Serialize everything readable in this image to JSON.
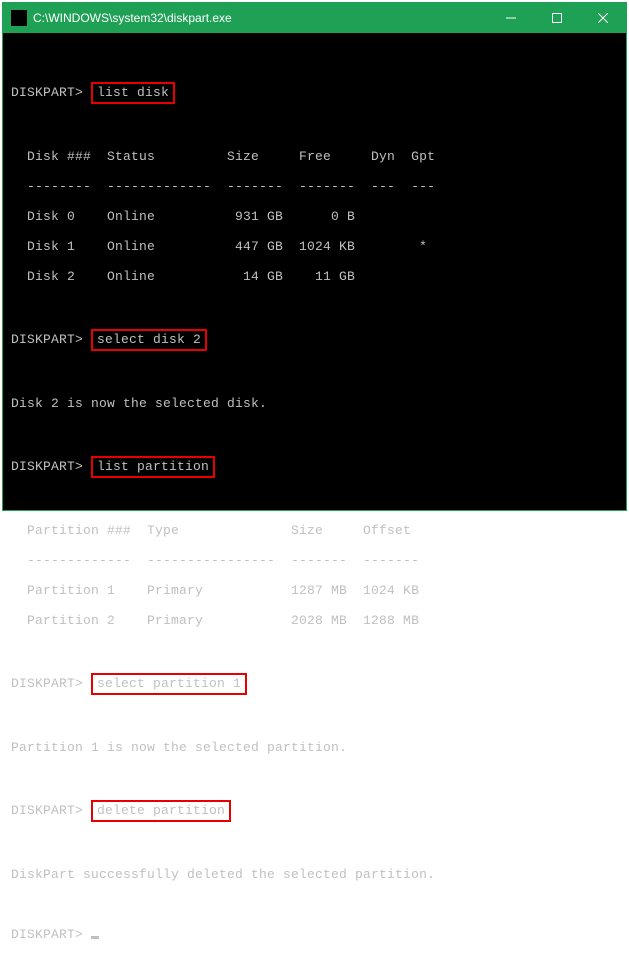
{
  "titlebar": {
    "path": "C:\\WINDOWS\\system32\\diskpart.exe"
  },
  "prompt": "DISKPART>",
  "commands": {
    "list_disk": "list disk",
    "select_disk": "select disk 2",
    "list_partition": "list partition",
    "select_partition": "select partition 1",
    "delete_partition": "delete partition"
  },
  "disk_table": {
    "header": "  Disk ###  Status         Size     Free     Dyn  Gpt",
    "divider": "  --------  -------------  -------  -------  ---  ---",
    "rows": [
      "  Disk 0    Online          931 GB      0 B",
      "  Disk 1    Online          447 GB  1024 KB        *",
      "  Disk 2    Online           14 GB    11 GB"
    ]
  },
  "messages": {
    "disk_selected": "Disk 2 is now the selected disk.",
    "partition_selected": "Partition 1 is now the selected partition.",
    "delete_success": "DiskPart successfully deleted the selected partition."
  },
  "partition_table": {
    "header": "  Partition ###  Type              Size     Offset",
    "divider": "  -------------  ----------------  -------  -------",
    "rows": [
      "  Partition 1    Primary           1287 MB  1024 KB",
      "  Partition 2    Primary           2028 MB  1288 MB"
    ]
  },
  "colors": {
    "titlebar_bg": "#1fa155",
    "terminal_bg": "#000000",
    "text": "#c0c0c0",
    "highlight_border": "#e60000"
  }
}
